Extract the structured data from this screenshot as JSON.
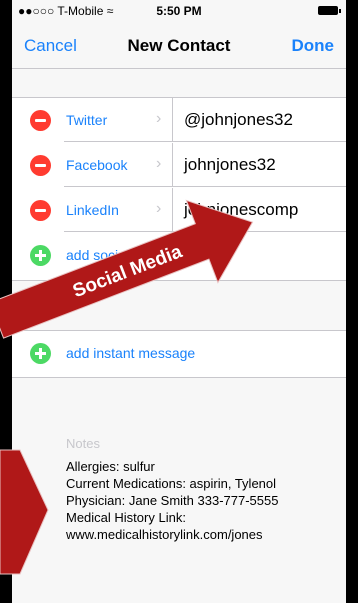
{
  "status": {
    "carrier": "●●○○○ T-Mobile",
    "wifi": "≈",
    "time": "5:50 PM"
  },
  "nav": {
    "cancel": "Cancel",
    "title": "New Contact",
    "done": "Done"
  },
  "social": [
    {
      "service": "Twitter",
      "value": "@johnjones32"
    },
    {
      "service": "Facebook",
      "value": "johnjones32"
    },
    {
      "service": "LinkedIn",
      "value": "johnjonescomp"
    }
  ],
  "add_social": "add social profile",
  "add_instant": "add instant message",
  "notes": {
    "label": "Notes",
    "lines": [
      "Allergies: sulfur",
      "Current Medications:  aspirin, Tylenol",
      "Physician: Jane Smith 333-777-5555",
      "Medical History Link:",
      "www.medicalhistorylink.com/jones"
    ]
  },
  "annotation": {
    "text": "Social Media",
    "color": "#b01818"
  }
}
